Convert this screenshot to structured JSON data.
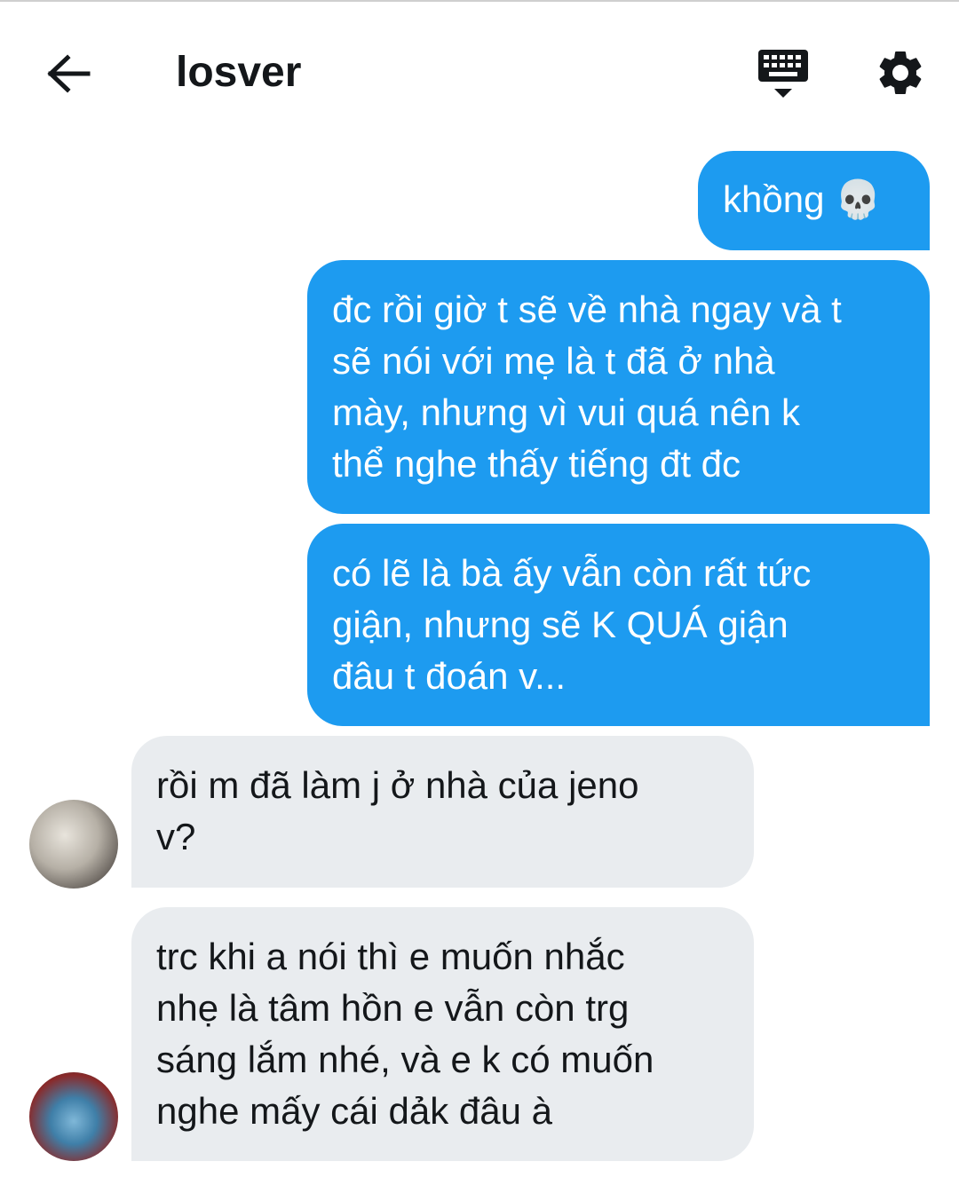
{
  "header": {
    "title": "losver",
    "back_icon": "arrow-left-icon",
    "keyboard_icon": "keyboard-icon",
    "settings_icon": "gear-icon"
  },
  "messages": [
    {
      "direction": "sent",
      "text": "khồng 💀"
    },
    {
      "direction": "sent",
      "text": "đc rồi giờ t sẽ về nhà ngay và t\nsẽ nói với mẹ là t đã ở nhà\nmày, nhưng vì vui quá nên k\nthể nghe thấy tiếng đt đc"
    },
    {
      "direction": "sent",
      "text": "có lẽ là bà ấy vẫn còn rất tức\ngiận, nhưng sẽ K QUÁ giận\nđâu t đoán v..."
    },
    {
      "direction": "received",
      "text": "rồi m đã làm j ở nhà của jeno\nv?"
    },
    {
      "direction": "received",
      "text": "trc khi a nói thì e muốn nhắc\nnhẹ là tâm hồn e vẫn còn trg\nsáng lắm nhé, và e k có muốn\nnghe mấy cái dảk đâu à"
    }
  ],
  "colors": {
    "sent_bubble": "#1d9bf0",
    "received_bubble": "#e9ecef",
    "text_dark": "#14171a"
  }
}
